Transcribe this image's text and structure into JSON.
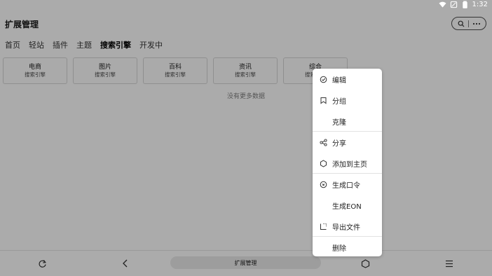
{
  "status": {
    "time": "1:32"
  },
  "header": {
    "title": "扩展管理"
  },
  "tabs": [
    {
      "label": "首页",
      "active": false
    },
    {
      "label": "轻站",
      "active": false
    },
    {
      "label": "插件",
      "active": false
    },
    {
      "label": "主题",
      "active": false
    },
    {
      "label": "搜索引擎",
      "active": true
    },
    {
      "label": "开发中",
      "active": false
    }
  ],
  "cards": [
    {
      "title": "电商",
      "subtitle": "搜索引擎"
    },
    {
      "title": "图片",
      "subtitle": "搜索引擎"
    },
    {
      "title": "百科",
      "subtitle": "搜索引擎"
    },
    {
      "title": "资讯",
      "subtitle": "搜索引擎"
    },
    {
      "title": "综合",
      "subtitle": "搜索引擎"
    }
  ],
  "empty_text": "没有更多数据",
  "menu": {
    "items": [
      {
        "label": "编辑",
        "icon": "edit-icon"
      },
      {
        "label": "分组",
        "icon": "bookmark-icon"
      },
      {
        "label": "克隆",
        "icon": ""
      },
      {
        "label": "分享",
        "icon": "share-icon"
      },
      {
        "label": "添加到主页",
        "icon": "hexagon-icon"
      },
      {
        "label": "生成口令",
        "icon": "link-circle-icon"
      },
      {
        "label": "生成EON",
        "icon": ""
      },
      {
        "label": "导出文件",
        "icon": "export-icon"
      },
      {
        "label": "删除",
        "icon": ""
      }
    ]
  },
  "bottom": {
    "address": "扩展管理"
  },
  "colors": {
    "background": "#ababab",
    "menu_bg": "#ffffff"
  }
}
